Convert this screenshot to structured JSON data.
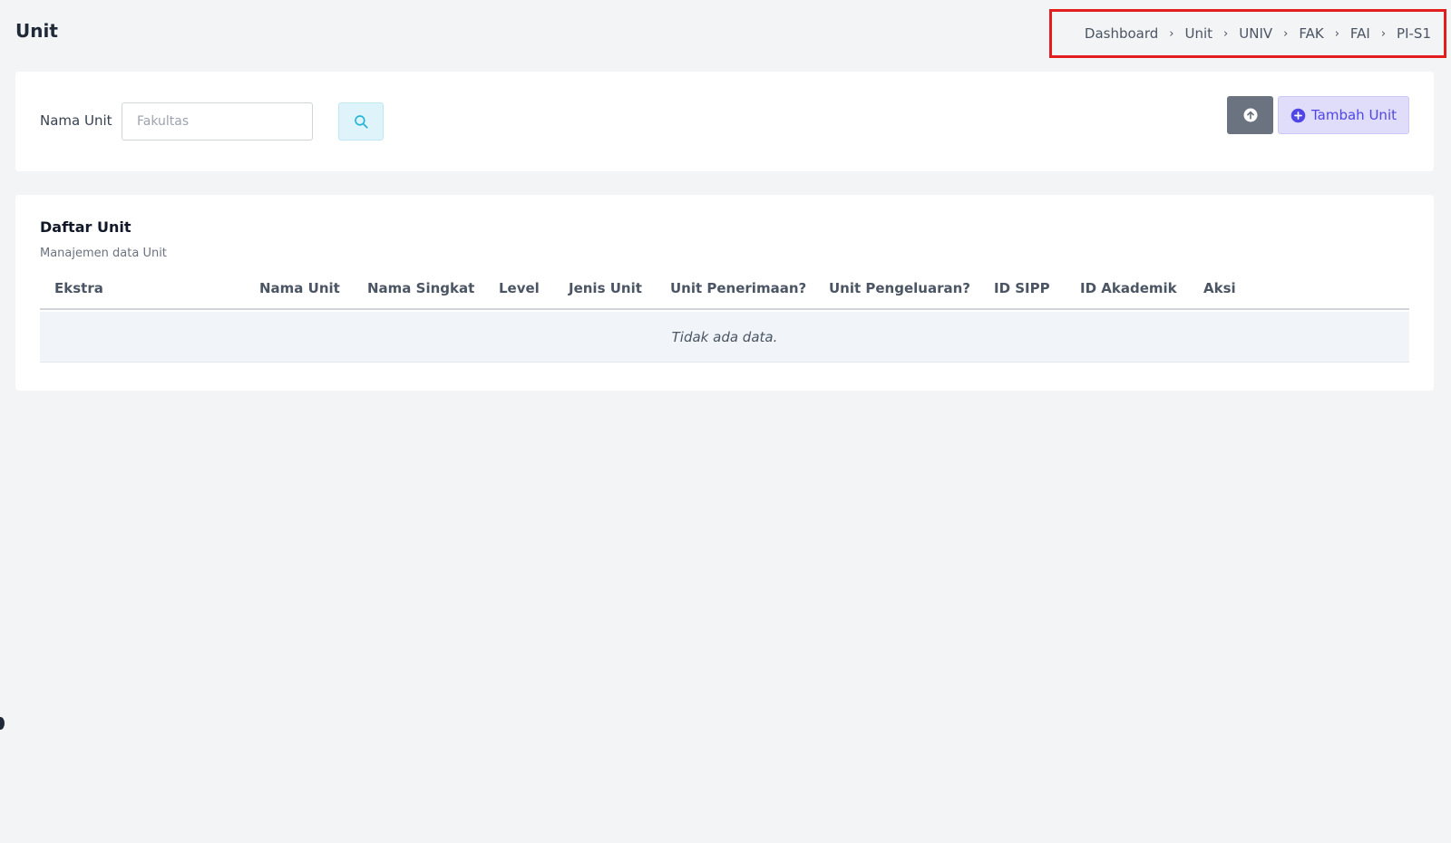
{
  "page": {
    "title": "Unit"
  },
  "breadcrumb": [
    "Dashboard",
    "Unit",
    "UNIV",
    "FAK",
    "FAI",
    "PI-S1"
  ],
  "filter": {
    "label": "Nama Unit",
    "placeholder": "Fakultas",
    "add_button": "Tambah Unit"
  },
  "list": {
    "title": "Daftar Unit",
    "subtitle": "Manajemen data Unit",
    "columns": [
      "Ekstra",
      "Nama Unit",
      "Nama Singkat",
      "Level",
      "Jenis Unit",
      "Unit Penerimaan?",
      "Unit Pengeluaran?",
      "ID SIPP",
      "ID Akademik",
      "Aksi"
    ],
    "empty_text": "Tidak ada data."
  },
  "colors": {
    "background": "#f3f4f6",
    "highlight_border": "#e11d1d",
    "add_button_accent": "#4f46e5",
    "upload_button": "#6b7280",
    "search_button": "#dff3fb"
  },
  "icons": {
    "search": "search-icon",
    "upload": "upload-icon",
    "add": "plus-circle-icon",
    "separator": "chevron-right-icon"
  }
}
